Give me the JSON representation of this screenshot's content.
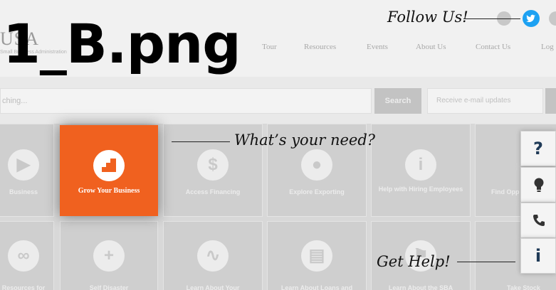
{
  "file_title": "1_B.png",
  "site": {
    "logo": "USA",
    "logo_sub": "Small Business Administration",
    "nav": [
      "Tour",
      "Resources",
      "Events",
      "About Us",
      "Contact Us",
      "Log"
    ],
    "search_placeholder": "ching...",
    "search_button": "Search",
    "email_placeholder": "Receive e-mail updates"
  },
  "tiles_row1": [
    {
      "label": "Business",
      "icon": "play-icon"
    },
    {
      "label": "Access Financing",
      "icon": "dollar-icon"
    },
    {
      "label": "Explore Exporting",
      "icon": "globe-icon"
    },
    {
      "label": "Help with Hiring Employees",
      "icon": "info-icon"
    },
    {
      "label": "Find Opp",
      "icon": "tile-icon"
    }
  ],
  "tiles_row2": [
    {
      "label": "Resources for",
      "icon": "ribbon-icon"
    },
    {
      "label": "Self Disaster",
      "icon": "plus-icon"
    },
    {
      "label": "Learn About Your",
      "icon": "pulse-icon"
    },
    {
      "label": "Learn About Loans and",
      "icon": "document-icon"
    },
    {
      "label": "Learn About the SBA",
      "icon": "flag-icon"
    },
    {
      "label": "Take Stock",
      "icon": "tile-icon"
    }
  ],
  "featured_tile": {
    "label": "Grow Your Business",
    "icon": "stairs-icon",
    "color": "#f0611f"
  },
  "annotations": {
    "follow": "Follow Us!",
    "need": "What’s your need?",
    "help": "Get Help!"
  },
  "social": {
    "icon": "twitter-icon",
    "color": "#1da1f2"
  },
  "help_rail": [
    {
      "name": "question",
      "glyph": "?",
      "icon": "question-icon"
    },
    {
      "name": "ideas",
      "glyph": "",
      "icon": "lightbulb-icon"
    },
    {
      "name": "phone",
      "glyph": "",
      "icon": "phone-icon"
    },
    {
      "name": "info",
      "glyph": "i",
      "icon": "info-icon"
    }
  ],
  "colors": {
    "accent": "#f0611f",
    "rail_icon": "#1f3a57",
    "twitter": "#1da1f2"
  }
}
